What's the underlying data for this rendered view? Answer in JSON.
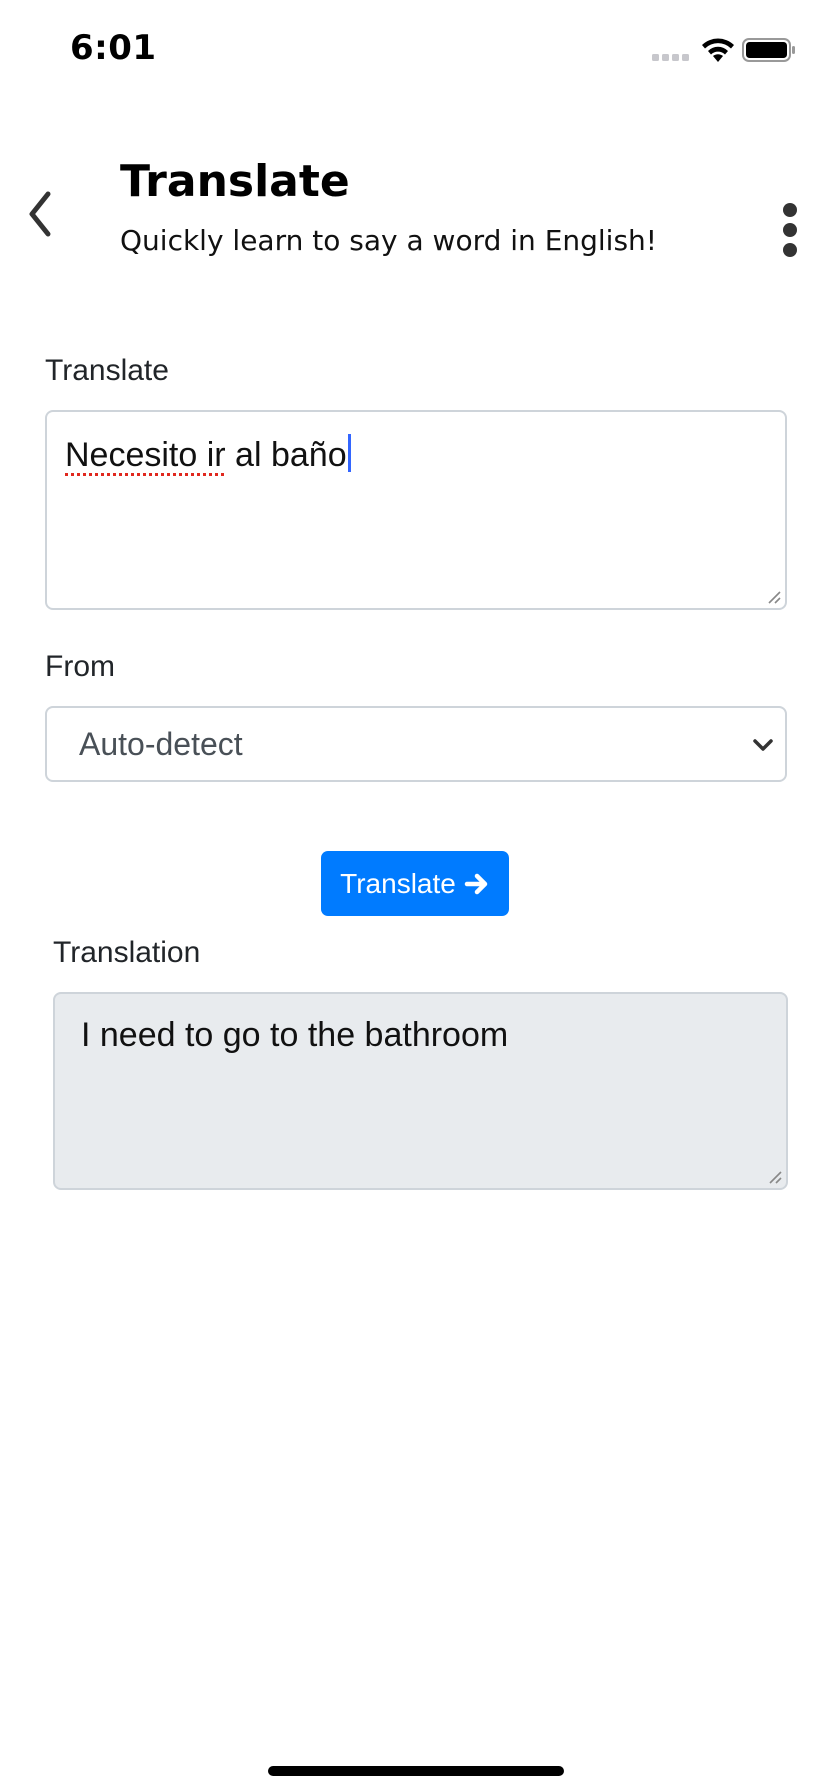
{
  "status_bar": {
    "time": "6:01",
    "icons": [
      "signal-icon",
      "wifi-icon",
      "battery-icon"
    ]
  },
  "header": {
    "title": "Translate",
    "subtitle": "Quickly learn to say a word in English!",
    "back_icon": "chevron-left-icon",
    "menu_icon": "more-vertical-icon"
  },
  "form": {
    "input_label": "Translate",
    "input_value_misspelled": "Necesito ir",
    "input_value_rest": " al baño",
    "from_label": "From",
    "from_selected": "Auto-detect",
    "translate_button_label": "Translate",
    "translate_button_icon": "arrow-right-icon",
    "output_label": "Translation",
    "output_value": "I need to go to the bathroom"
  },
  "colors": {
    "primary": "#007bff",
    "readonly_bg": "#e8ebee",
    "border": "#ced4da",
    "spell_error": "#e0281e",
    "caret": "#3366ff"
  }
}
